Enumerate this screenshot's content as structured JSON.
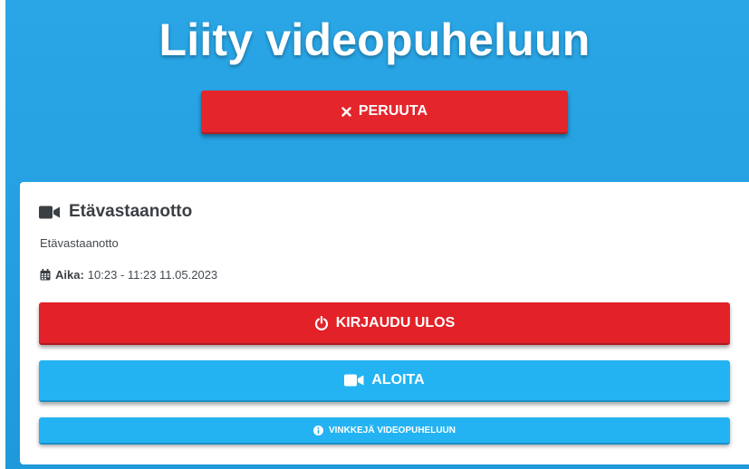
{
  "colors": {
    "background": "#239fe0",
    "cancel_button": "#e4262c",
    "logout_button": "#e22128",
    "start_button": "#24b3f2",
    "tips_button": "#24b3f2",
    "card": "#ffffff"
  },
  "header": {
    "title": "Liity videopuheluun"
  },
  "cancel_button": {
    "icon": "close-icon",
    "label": "PERUUTA"
  },
  "card": {
    "icon": "video-camera-icon",
    "title": "Etävastaanotto",
    "subtitle": "Etävastaanotto",
    "time": {
      "icon": "calendar-icon",
      "label": "Aika:",
      "value": "10:23 - 11:23 11.05.2023"
    },
    "logout_button": {
      "icon": "power-icon",
      "label": "KIRJAUDU ULOS"
    },
    "start_button": {
      "icon": "video-camera-icon",
      "label": "ALOITA"
    },
    "tips_button": {
      "icon": "info-icon",
      "label": "VINKKEJÄ VIDEOPUHELUUN"
    }
  }
}
